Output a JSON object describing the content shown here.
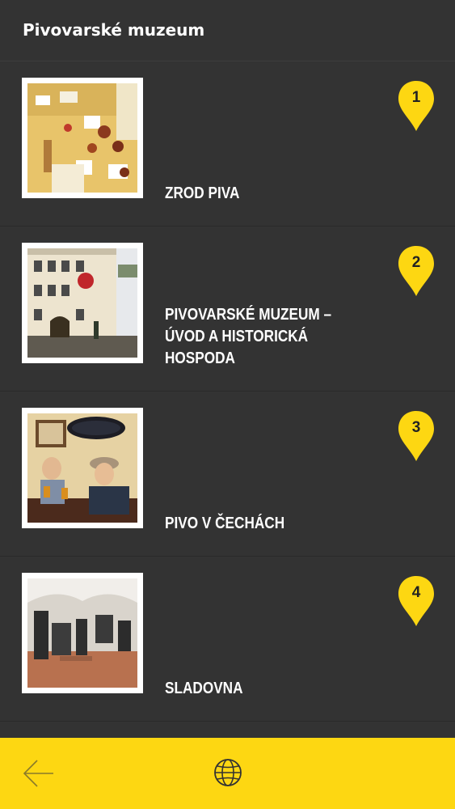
{
  "header": {
    "title": "Pivovarské muzeum"
  },
  "items": [
    {
      "number": "1",
      "title": "ZROD PIVA"
    },
    {
      "number": "2",
      "title": "PIVOVARSKÉ MUZEUM – ÚVOD A HISTORICKÁ HOSPODA"
    },
    {
      "number": "3",
      "title": "PIVO V ČECHÁCH"
    },
    {
      "number": "4",
      "title": "SLADOVNA"
    }
  ],
  "footer": {
    "back_icon": "arrow-left-icon",
    "language_icon": "globe-icon"
  },
  "colors": {
    "background": "#333333",
    "accent": "#fdd712",
    "text": "#ffffff"
  }
}
